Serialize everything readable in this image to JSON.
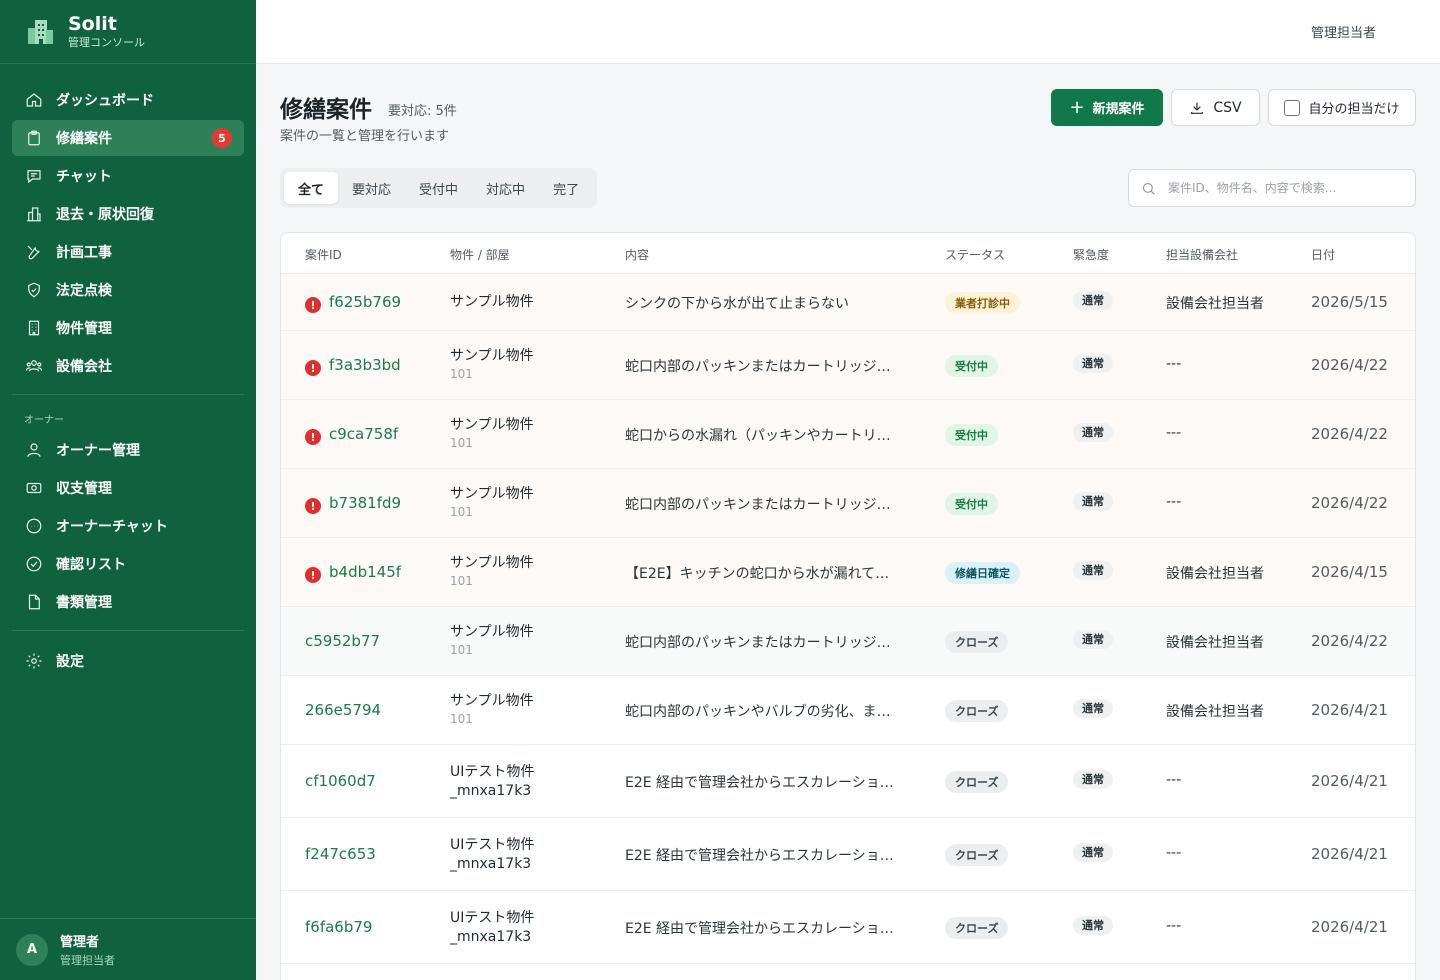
{
  "brand": {
    "name": "Solit",
    "subtitle": "管理コンソール"
  },
  "sidebar": {
    "items": [
      {
        "label": "ダッシュボード",
        "icon": "home-icon"
      },
      {
        "label": "修繕案件",
        "icon": "clipboard-icon",
        "badge": "5",
        "active": true
      },
      {
        "label": "チャット",
        "icon": "chat-icon"
      },
      {
        "label": "退去・原状回復",
        "icon": "building-chart-icon"
      },
      {
        "label": "計画工事",
        "icon": "tools-icon"
      },
      {
        "label": "法定点検",
        "icon": "shield-check-icon"
      },
      {
        "label": "物件管理",
        "icon": "building-icon"
      },
      {
        "label": "設備会社",
        "icon": "group-icon"
      }
    ],
    "owner_section": "オーナー",
    "owner_items": [
      {
        "label": "オーナー管理",
        "icon": "user-icon"
      },
      {
        "label": "収支管理",
        "icon": "money-icon"
      },
      {
        "label": "オーナーチャット",
        "icon": "chat-bubble-icon"
      },
      {
        "label": "確認リスト",
        "icon": "check-circle-icon"
      },
      {
        "label": "書類管理",
        "icon": "document-icon"
      }
    ],
    "settings": {
      "label": "設定",
      "icon": "gear-icon"
    }
  },
  "user": {
    "initial": "A",
    "name": "管理者",
    "role": "管理担当者"
  },
  "topbar": {
    "user": "管理担当者"
  },
  "page": {
    "title": "修繕案件",
    "count": "要対応: 5件",
    "subtitle": "案件の一覧と管理を行います",
    "new_button": "新規案件",
    "csv_button": "CSV",
    "mine_label": "自分の担当だけ"
  },
  "tabs": [
    "全て",
    "要対応",
    "受付中",
    "対応中",
    "完了"
  ],
  "search": {
    "placeholder": "案件ID、物件名、内容で検索..."
  },
  "table": {
    "headers": [
      "案件ID",
      "物件 / 部屋",
      "内容",
      "ステータス",
      "緊急度",
      "担当設備会社",
      "日付"
    ],
    "rows": [
      {
        "id": "f625b769",
        "alert": true,
        "property": "サンプル物件",
        "room": "",
        "content": "シンクの下から水が出て止まらない",
        "status": "業者打診中",
        "status_color": "yellow",
        "urgency": "通常",
        "vendor": "設備会社担当者",
        "date": "2026/5/15"
      },
      {
        "id": "f3a3b3bd",
        "alert": true,
        "property": "サンプル物件",
        "room": "101",
        "content": "蛇口内部のパッキンまたはカートリッジ…",
        "status": "受付中",
        "status_color": "green",
        "urgency": "通常",
        "vendor": "---",
        "date": "2026/4/22"
      },
      {
        "id": "c9ca758f",
        "alert": true,
        "property": "サンプル物件",
        "room": "101",
        "content": "蛇口からの水漏れ（パッキンやカートリ…",
        "status": "受付中",
        "status_color": "green",
        "urgency": "通常",
        "vendor": "---",
        "date": "2026/4/22"
      },
      {
        "id": "b7381fd9",
        "alert": true,
        "property": "サンプル物件",
        "room": "101",
        "content": "蛇口内部のパッキンまたはカートリッジ…",
        "status": "受付中",
        "status_color": "green",
        "urgency": "通常",
        "vendor": "---",
        "date": "2026/4/22"
      },
      {
        "id": "b4db145f",
        "alert": true,
        "property": "サンプル物件",
        "room": "101",
        "content": "【E2E】キッチンの蛇口から水が漏れて…",
        "status": "修繕日確定",
        "status_color": "cyan",
        "urgency": "通常",
        "vendor": "設備会社担当者",
        "date": "2026/4/15"
      },
      {
        "id": "c5952b77",
        "alert": false,
        "property": "サンプル物件",
        "room": "101",
        "content": "蛇口内部のパッキンまたはカートリッジ…",
        "status": "クローズ",
        "status_color": "gray",
        "urgency": "通常",
        "vendor": "設備会社担当者",
        "date": "2026/4/22"
      },
      {
        "id": "266e5794",
        "alert": false,
        "property": "サンプル物件",
        "room": "101",
        "content": "蛇口内部のパッキンやバルブの劣化、ま…",
        "status": "クローズ",
        "status_color": "gray",
        "urgency": "通常",
        "vendor": "設備会社担当者",
        "date": "2026/4/21"
      },
      {
        "id": "cf1060d7",
        "alert": false,
        "property": "UIテスト物件\n_mnxa17k3",
        "room": "",
        "content": "E2E 経由で管理会社からエスカレーショ…",
        "status": "クローズ",
        "status_color": "gray",
        "urgency": "通常",
        "vendor": "---",
        "date": "2026/4/21"
      },
      {
        "id": "f247c653",
        "alert": false,
        "property": "UIテスト物件\n_mnxa17k3",
        "room": "",
        "content": "E2E 経由で管理会社からエスカレーショ…",
        "status": "クローズ",
        "status_color": "gray",
        "urgency": "通常",
        "vendor": "---",
        "date": "2026/4/21"
      },
      {
        "id": "f6fa6b79",
        "alert": false,
        "property": "UIテスト物件\n_mnxa17k3",
        "room": "",
        "content": "E2E 経由で管理会社からエスカレーショ…",
        "status": "クローズ",
        "status_color": "gray",
        "urgency": "通常",
        "vendor": "---",
        "date": "2026/4/21"
      }
    ]
  }
}
